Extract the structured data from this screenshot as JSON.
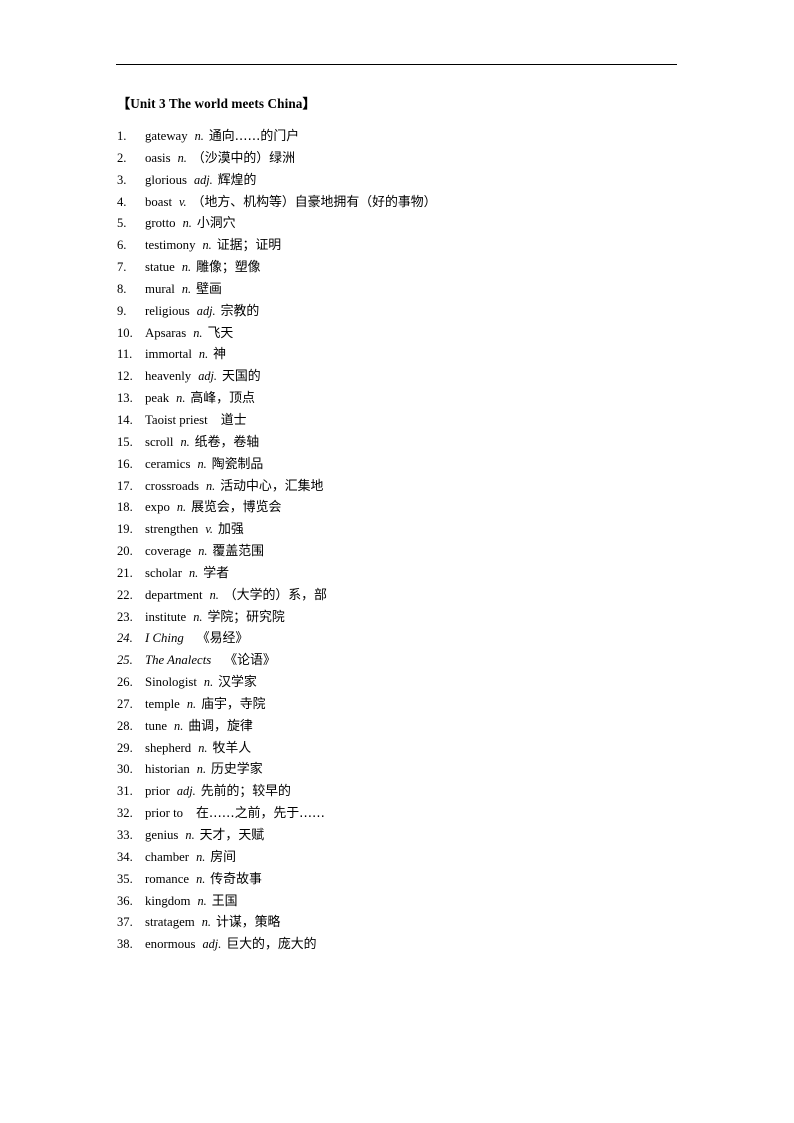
{
  "document": {
    "title": "【Unit 3 The world meets China】",
    "has_header_rule": true
  },
  "vocabulary": {
    "items": [
      {
        "num": "1.",
        "word": "gateway",
        "pos": "n.",
        "definition": "通向……的门户"
      },
      {
        "num": "2.",
        "word": "oasis",
        "pos": "n.",
        "definition": "（沙漠中的）绿洲"
      },
      {
        "num": "3.",
        "word": "glorious",
        "pos": "adj.",
        "definition": "辉煌的"
      },
      {
        "num": "4.",
        "word": "boast",
        "pos": "v.",
        "definition": "（地方、机构等）自豪地拥有（好的事物）"
      },
      {
        "num": "5.",
        "word": "grotto",
        "pos": "n.",
        "definition": "小洞穴"
      },
      {
        "num": "6.",
        "word": "testimony",
        "pos": "n.",
        "definition": "证据；证明"
      },
      {
        "num": "7.",
        "word": "statue",
        "pos": "n.",
        "definition": "雕像；塑像"
      },
      {
        "num": "8.",
        "word": "mural",
        "pos": "n.",
        "definition": "壁画"
      },
      {
        "num": "9.",
        "word": "religious",
        "pos": "adj.",
        "definition": "宗教的"
      },
      {
        "num": "10.",
        "word": "Apsaras",
        "pos": "n.",
        "definition": "飞天"
      },
      {
        "num": "11.",
        "word": "immortal",
        "pos": "n.",
        "definition": "神"
      },
      {
        "num": "12.",
        "word": "heavenly",
        "pos": "adj.",
        "definition": "天国的"
      },
      {
        "num": "13.",
        "word": "peak",
        "pos": "n.",
        "definition": "高峰，顶点"
      },
      {
        "num": "14.",
        "word": "Taoist priest",
        "pos": "",
        "definition": "道士"
      },
      {
        "num": "15.",
        "word": "scroll",
        "pos": "n.",
        "definition": "纸卷，卷轴"
      },
      {
        "num": "16.",
        "word": "ceramics",
        "pos": "n.",
        "definition": "陶瓷制品"
      },
      {
        "num": "17.",
        "word": "crossroads",
        "pos": "n.",
        "definition": "活动中心，汇集地"
      },
      {
        "num": "18.",
        "word": "expo",
        "pos": "n.",
        "definition": "展览会，博览会"
      },
      {
        "num": "19.",
        "word": "strengthen",
        "pos": "v.",
        "definition": "加强"
      },
      {
        "num": "20.",
        "word": "coverage",
        "pos": "n.",
        "definition": "覆盖范围"
      },
      {
        "num": "21.",
        "word": "scholar",
        "pos": "n.",
        "definition": "学者"
      },
      {
        "num": "22.",
        "word": "department",
        "pos": "n.",
        "definition": "（大学的）系，部"
      },
      {
        "num": "23.",
        "word": "institute",
        "pos": "n.",
        "definition": "学院；研究院"
      },
      {
        "num": "24.",
        "word": "I Ching",
        "pos": "",
        "definition": "《易经》",
        "italic": true
      },
      {
        "num": "25.",
        "word": "The Analects",
        "pos": "",
        "definition": "《论语》",
        "italic": true
      },
      {
        "num": "26.",
        "word": "Sinologist",
        "pos": "n.",
        "definition": "汉学家"
      },
      {
        "num": "27.",
        "word": "temple",
        "pos": "n.",
        "definition": "庙宇，寺院"
      },
      {
        "num": "28.",
        "word": "tune",
        "pos": "n.",
        "definition": "曲调，旋律"
      },
      {
        "num": "29.",
        "word": "shepherd",
        "pos": "n.",
        "definition": "牧羊人"
      },
      {
        "num": "30.",
        "word": "historian",
        "pos": "n.",
        "definition": "历史学家"
      },
      {
        "num": "31.",
        "word": "prior",
        "pos": "adj.",
        "definition": "先前的；较早的"
      },
      {
        "num": "32.",
        "word": "prior to",
        "pos": "",
        "definition": "在……之前，先于……"
      },
      {
        "num": "33.",
        "word": "genius",
        "pos": "n.",
        "definition": "天才，天赋"
      },
      {
        "num": "34.",
        "word": "chamber",
        "pos": "n.",
        "definition": "房间"
      },
      {
        "num": "35.",
        "word": "romance",
        "pos": "n.",
        "definition": "传奇故事"
      },
      {
        "num": "36.",
        "word": "kingdom",
        "pos": "n.",
        "definition": "王国"
      },
      {
        "num": "37.",
        "word": "stratagem",
        "pos": "n.",
        "definition": "计谋，策略"
      },
      {
        "num": "38.",
        "word": "enormous",
        "pos": "adj.",
        "definition": "巨大的，庞大的"
      }
    ]
  }
}
